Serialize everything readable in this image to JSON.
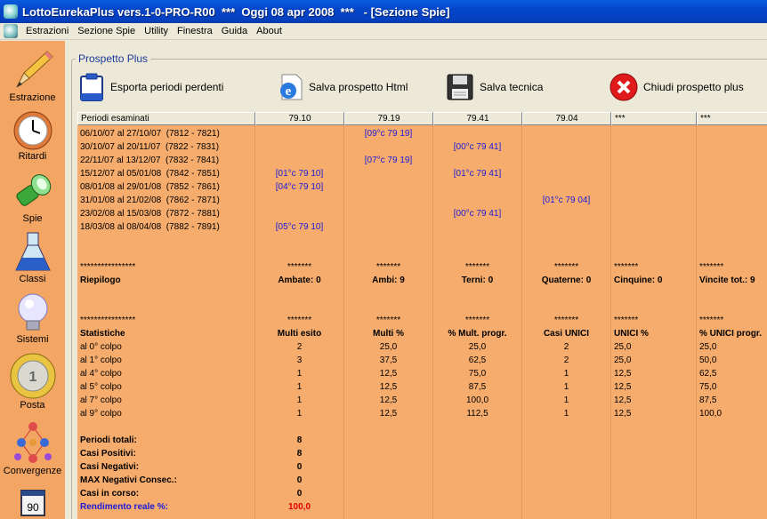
{
  "window": {
    "title": "LottoEurekaPlus vers.1-0-PRO-R00  ***  Oggi 08 apr 2008  ***   - [Sezione Spie]"
  },
  "menu": [
    "Estrazioni",
    "Sezione Spie",
    "Utility",
    "Finestra",
    "Guida",
    "About"
  ],
  "sidebar": {
    "items": [
      {
        "label": "Estrazione",
        "icon": "pencil-icon"
      },
      {
        "label": "Ritardi",
        "icon": "clock-icon"
      },
      {
        "label": "Spie",
        "icon": "flashlight-icon"
      },
      {
        "label": "Classi",
        "icon": "flask-icon"
      },
      {
        "label": "Sistemi",
        "icon": "lightbulb-icon"
      },
      {
        "label": "Posta",
        "icon": "coin-icon"
      },
      {
        "label": "Convergenze",
        "icon": "network-icon"
      },
      {
        "label": "",
        "icon": "ticket-90-icon",
        "badge": "90"
      }
    ]
  },
  "panel": {
    "title": "Prospetto Plus",
    "buttons": [
      {
        "label": "Esporta periodi perdenti",
        "icon": "clipboard-icon"
      },
      {
        "label": "Salva prospetto Html",
        "icon": "ie-document-icon"
      },
      {
        "label": "Salva tecnica",
        "icon": "floppy-icon"
      },
      {
        "label": "Chiudi prospetto plus",
        "icon": "close-icon"
      }
    ]
  },
  "grid": {
    "headers": [
      "Periodi esaminati",
      "79.10",
      "79.19",
      "79.41",
      "79.04",
      "***",
      "***"
    ],
    "rows": [
      [
        "06/10/07 al 27/10/07  (7812 - 7821)",
        "",
        "[09°c 79 19]",
        "",
        "",
        "",
        ""
      ],
      [
        "30/10/07 al 20/11/07  (7822 - 7831)",
        "",
        "",
        "[00°c 79 41]",
        "",
        "",
        ""
      ],
      [
        "22/11/07 al 13/12/07  (7832 - 7841)",
        "",
        "[07°c 79 19]",
        "",
        "",
        "",
        ""
      ],
      [
        "15/12/07 al 05/01/08  (7842 - 7851)",
        "[01°c 79 10]",
        "",
        "[01°c 79 41]",
        "",
        "",
        ""
      ],
      [
        "08/01/08 al 29/01/08  (7852 - 7861)",
        "[04°c 79 10]",
        "",
        "",
        "",
        "",
        ""
      ],
      [
        "31/01/08 al 21/02/08  (7862 - 7871)",
        "",
        "",
        "",
        "[01°c 79 04]",
        "",
        ""
      ],
      [
        "23/02/08 al 15/03/08  (7872 - 7881)",
        "",
        "",
        "[00°c 79 41]",
        "",
        "",
        ""
      ],
      [
        "18/03/08 al 08/04/08  (7882 - 7891)",
        "[05°c 79 10]",
        "",
        "",
        "",
        "",
        ""
      ],
      [
        "",
        "",
        "",
        "",
        "",
        "",
        ""
      ],
      [
        "",
        "",
        "",
        "",
        "",
        "",
        ""
      ],
      [
        "****************",
        "*******",
        "*******",
        "*******",
        "*******",
        "*******",
        "*******"
      ],
      [
        "Riepilogo",
        "Ambate: 0",
        "Ambi: 9",
        "Terni: 0",
        "Quaterne: 0",
        "Cinquine: 0",
        "Vincite tot.: 9"
      ],
      [
        "",
        "",
        "",
        "",
        "",
        "",
        ""
      ],
      [
        "",
        "",
        "",
        "",
        "",
        "",
        ""
      ],
      [
        "****************",
        "*******",
        "*******",
        "*******",
        "*******",
        "*******",
        "*******"
      ],
      [
        "Statistiche",
        "Multi esito",
        "Multi %",
        "% Mult. progr.",
        "Casi UNICI",
        "UNICI %",
        "% UNICI progr."
      ],
      [
        "al 0° colpo",
        "2",
        "25,0",
        "25,0",
        "2",
        "25,0",
        "25,0"
      ],
      [
        "al 1° colpo",
        "3",
        "37,5",
        "62,5",
        "2",
        "25,0",
        "50,0"
      ],
      [
        "al 4° colpo",
        "1",
        "12,5",
        "75,0",
        "1",
        "12,5",
        "62,5"
      ],
      [
        "al 5° colpo",
        "1",
        "12,5",
        "87,5",
        "1",
        "12,5",
        "75,0"
      ],
      [
        "al 7° colpo",
        "1",
        "12,5",
        "100,0",
        "1",
        "12,5",
        "87,5"
      ],
      [
        "al 9° colpo",
        "1",
        "12,5",
        "112,5",
        "1",
        "12,5",
        "100,0"
      ],
      [
        "",
        "",
        "",
        "",
        "",
        "",
        ""
      ],
      [
        "Periodi totali:",
        "8",
        "",
        "",
        "",
        "",
        ""
      ],
      [
        "Casi Positivi:",
        "8",
        "",
        "",
        "",
        "",
        ""
      ],
      [
        "Casi Negativi:",
        "0",
        "",
        "",
        "",
        "",
        ""
      ],
      [
        "MAX Negativi Consec.:",
        "0",
        "",
        "",
        "",
        "",
        ""
      ],
      [
        "Casi in corso:",
        "0",
        "",
        "",
        "",
        "",
        ""
      ],
      [
        "Rendimento reale %:",
        "100,0",
        "",
        "",
        "",
        "",
        ""
      ]
    ]
  }
}
